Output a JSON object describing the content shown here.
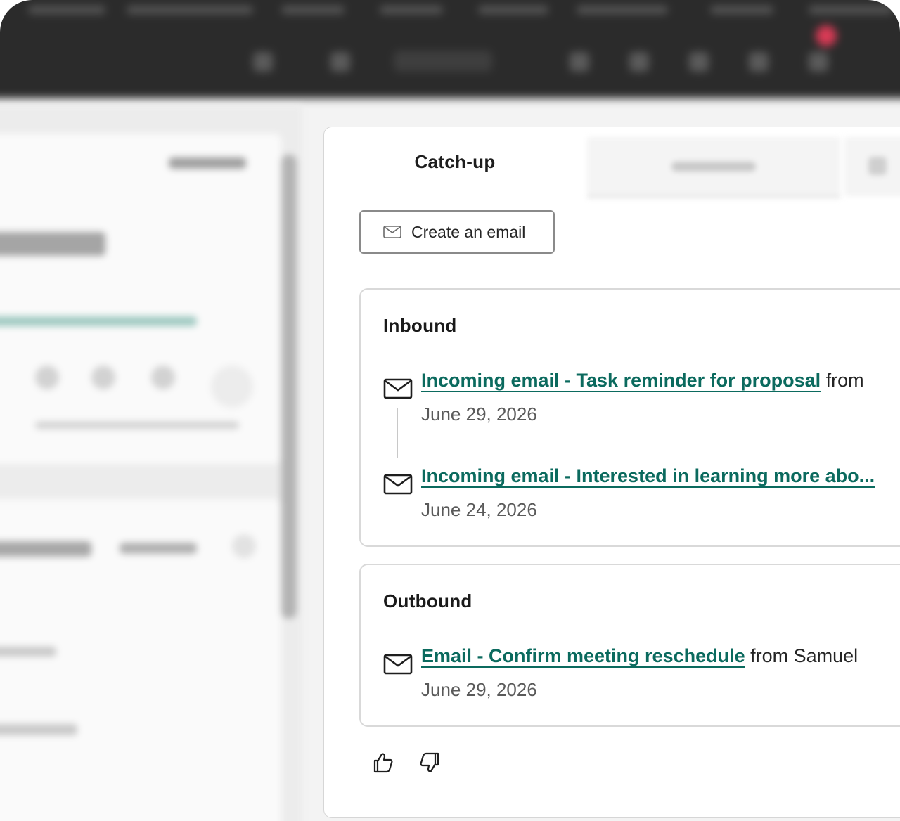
{
  "tabs": {
    "active_label": "Catch-up"
  },
  "toolbar": {
    "create_email_label": "Create an email"
  },
  "inbound": {
    "heading": "Inbound",
    "items": [
      {
        "title": "Incoming email - Task reminder for proposal",
        "suffix": " from",
        "date": "June 29, 2026"
      },
      {
        "title": "Incoming email - Interested in learning more abo...",
        "suffix": "",
        "date": "June 24, 2026"
      }
    ]
  },
  "outbound": {
    "heading": "Outbound",
    "items": [
      {
        "title": "Email - Confirm meeting reschedule",
        "suffix": " from Samuel",
        "date": "June 29, 2026"
      }
    ]
  },
  "feedback": {
    "thumbs_up_icon": "thumbs-up-icon",
    "thumbs_down_icon": "thumbs-down-icon"
  },
  "colors": {
    "link": "#0b6a5e",
    "topbar": "#2b2b2b",
    "notification": "#d83a55"
  }
}
